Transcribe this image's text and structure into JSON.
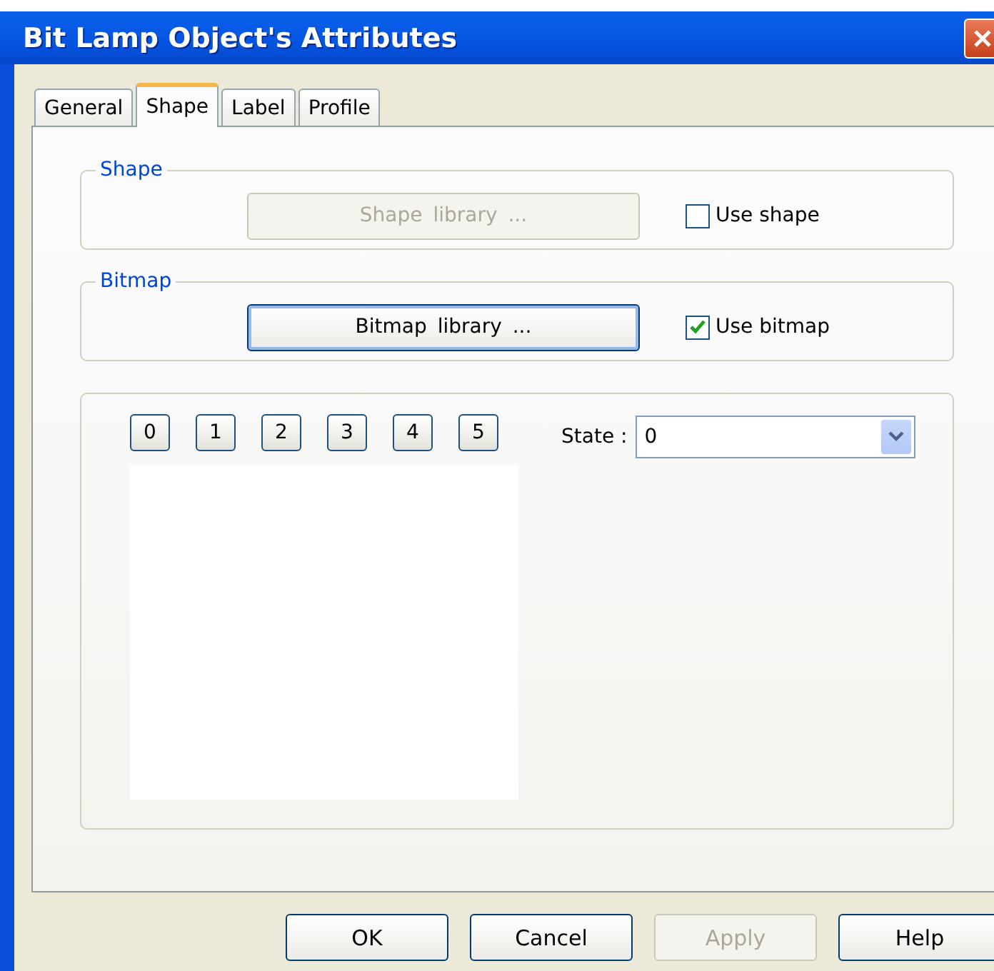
{
  "window": {
    "title": "Bit Lamp Object's Attributes"
  },
  "tabs": [
    {
      "label": "General",
      "selected": false
    },
    {
      "label": "Shape",
      "selected": true
    },
    {
      "label": "Label",
      "selected": false
    },
    {
      "label": "Profile",
      "selected": false
    }
  ],
  "shape_group": {
    "title": "Shape",
    "button": {
      "label": "Shape  library ...",
      "disabled": true
    },
    "checkbox": {
      "label": "Use shape",
      "checked": false
    }
  },
  "bitmap_group": {
    "title": "Bitmap",
    "button": {
      "label": "Bitmap  library ...",
      "disabled": false
    },
    "checkbox": {
      "label": "Use bitmap",
      "checked": true
    }
  },
  "state_buttons": [
    "0",
    "1",
    "2",
    "3",
    "4",
    "5"
  ],
  "state": {
    "label": "State :",
    "value": "0"
  },
  "buttons": [
    {
      "label": "OK",
      "disabled": false
    },
    {
      "label": "Cancel",
      "disabled": false
    },
    {
      "label": "Apply",
      "disabled": true
    },
    {
      "label": "Help",
      "disabled": false
    }
  ]
}
